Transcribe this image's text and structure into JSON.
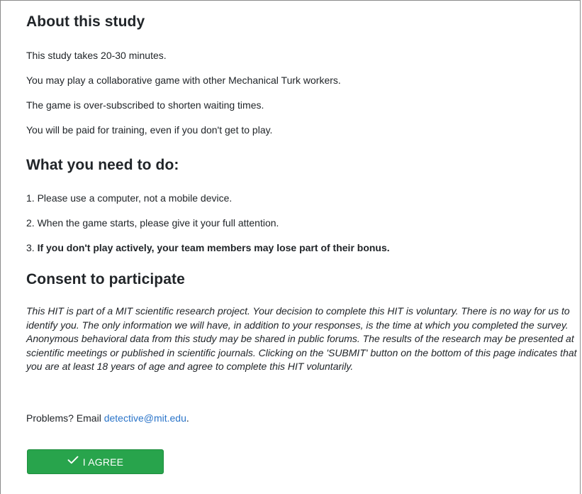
{
  "about": {
    "heading": "About this study",
    "lines": [
      "This study takes 20-30 minutes.",
      "You may play a collaborative game with other Mechanical Turk workers.",
      "The game is over-subscribed to shorten waiting times.",
      "You will be paid for training, even if you don't get to play."
    ]
  },
  "todo": {
    "heading": "What you need to do:",
    "items": [
      {
        "number": "1.",
        "text": "Please use a computer, not a mobile device."
      },
      {
        "number": "2.",
        "text": "When the game starts, please give it your full attention."
      },
      {
        "number": "3.",
        "text": "If you don't play actively, your team members may lose part of their bonus."
      }
    ]
  },
  "consent": {
    "heading": "Consent to participate",
    "text": "This HIT is part of a MIT scientific research project. Your decision to complete this HIT is voluntary. There is no way for us to identify you. The only information we will have, in addition to your responses, is the time at which you completed the survey. Anonymous behavioral data from this study may be shared in public forums. The results of the research may be presented at scientific meetings or published in scientific journals. Clicking on the 'SUBMIT' button on the bottom of this page indicates that you are at least 18 years of age and agree to complete this HIT voluntarily.",
    "problems_prefix": "Problems? Email ",
    "email": "detective@mit.edu",
    "problems_suffix": "."
  },
  "agree_button": {
    "label": "I AGREE",
    "icon": "check-icon",
    "color": "#28a44c"
  }
}
